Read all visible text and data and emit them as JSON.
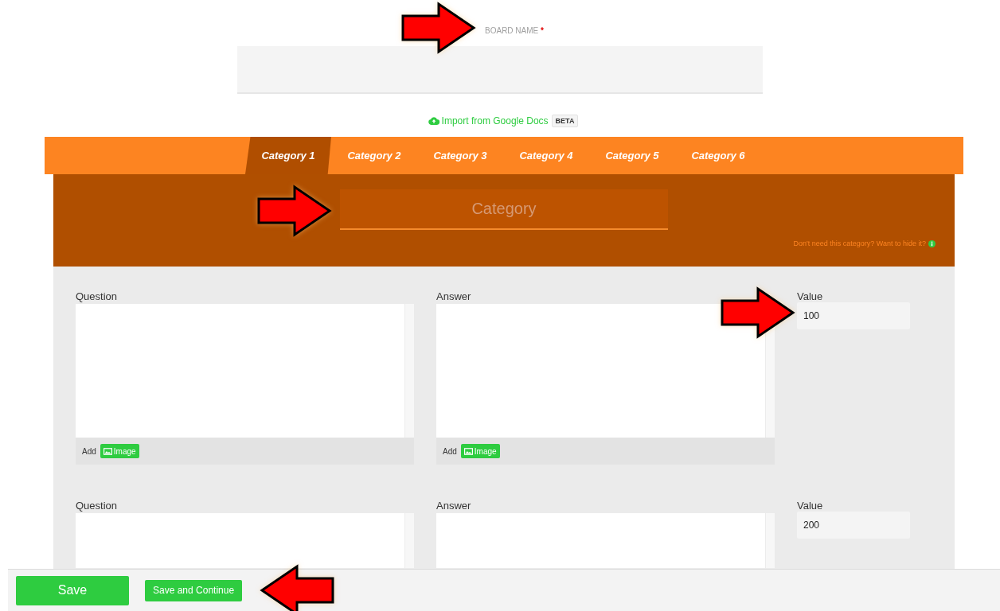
{
  "board_name": {
    "label": "BOARD NAME",
    "required_mark": "*",
    "pointed": true
  },
  "import_link": {
    "label": "Import from Google Docs",
    "badge": "BETA"
  },
  "tabs": [
    {
      "label": "Category 1",
      "selected": true
    },
    {
      "label": "Category 2",
      "selected": false
    },
    {
      "label": "Category 3",
      "selected": false
    },
    {
      "label": "Category 4",
      "selected": false
    },
    {
      "label": "Category 5",
      "selected": false
    },
    {
      "label": "Category 6",
      "selected": false
    }
  ],
  "category_field": {
    "placeholder": "Category",
    "pointed": true
  },
  "hide_hint": "Don't need this category? Want to hide it?",
  "clues": [
    {
      "question_label": "Question",
      "question_tools": {
        "add_label": "Add",
        "image_button": "Image"
      },
      "answer_label": "Answer",
      "answer_tools": {
        "add_label": "Add",
        "image_button": "Image"
      },
      "value_label": "Value",
      "value": "100",
      "value_pointed": true
    },
    {
      "question_label": "Question",
      "answer_label": "Answer",
      "value_label": "Value",
      "value": "200",
      "value_pointed": false
    }
  ],
  "footer": {
    "save": "Save",
    "save_continue": "Save and Continue",
    "pointed": true
  }
}
